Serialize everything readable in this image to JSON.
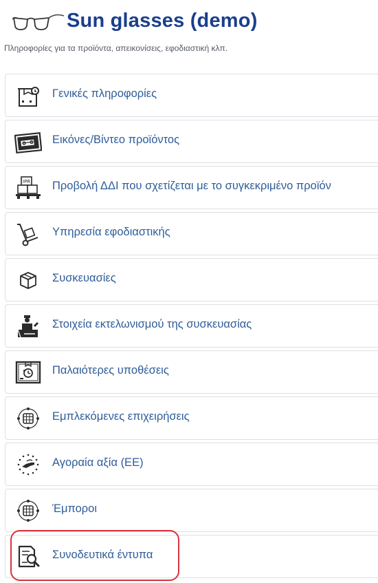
{
  "header": {
    "logo_icon": "eyeglasses-icon",
    "title": "Sun glasses (demo)",
    "subtitle": "Πληροφορίες για τα προϊόντα, απεικονίσεις, εφοδιαστική κλπ."
  },
  "menu": {
    "items": [
      {
        "label": "Γενικές πληροφορίες",
        "icon": "box-search-icon"
      },
      {
        "label": "Εικόνες/Βίντεο προϊόντος",
        "icon": "product-images-icon"
      },
      {
        "label": "Προβολή ΔΔΙ που σχετίζεται με το συγκεκριμένο προϊόν",
        "icon": "pallet-boxes-icon"
      },
      {
        "label": "Υπηρεσία εφοδιαστικής",
        "icon": "hand-truck-icon"
      },
      {
        "label": "Συσκευασίες",
        "icon": "package-cube-icon"
      },
      {
        "label": "Στοιχεία εκτελωνισμού της συσκευασίας",
        "icon": "customs-officer-icon"
      },
      {
        "label": "Παλαιότερες υποθέσεις",
        "icon": "case-history-icon"
      },
      {
        "label": "Εμπλεκόμενες επιχειρήσεις",
        "icon": "businesses-network-icon"
      },
      {
        "label": "Αγοραία αξία (ΕΕ)",
        "icon": "eu-value-icon"
      },
      {
        "label": "Έμποροι",
        "icon": "traders-network-icon"
      },
      {
        "label": "Συνοδευτικά έντυπα",
        "icon": "document-search-icon"
      }
    ]
  },
  "colors": {
    "title": "#1a3f8c",
    "link": "#2e5c99",
    "highlight_border": "#d9323f"
  }
}
